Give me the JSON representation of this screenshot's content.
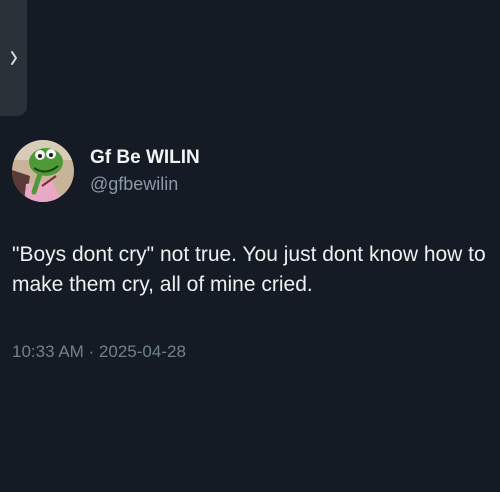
{
  "author": {
    "display_name": "Gf Be WILIN",
    "handle": "@gfbewilin"
  },
  "tweet": {
    "text": "\"Boys dont cry\" not true. You just dont know how to make them cry, all of mine cried.",
    "timestamp": "10:33 AM · 2025-04-28"
  },
  "icons": {
    "side_tab": "chevron-right-icon"
  },
  "colors": {
    "background": "#141b24",
    "text_primary": "#e7e9ea",
    "text_secondary": "#8b98a5"
  }
}
